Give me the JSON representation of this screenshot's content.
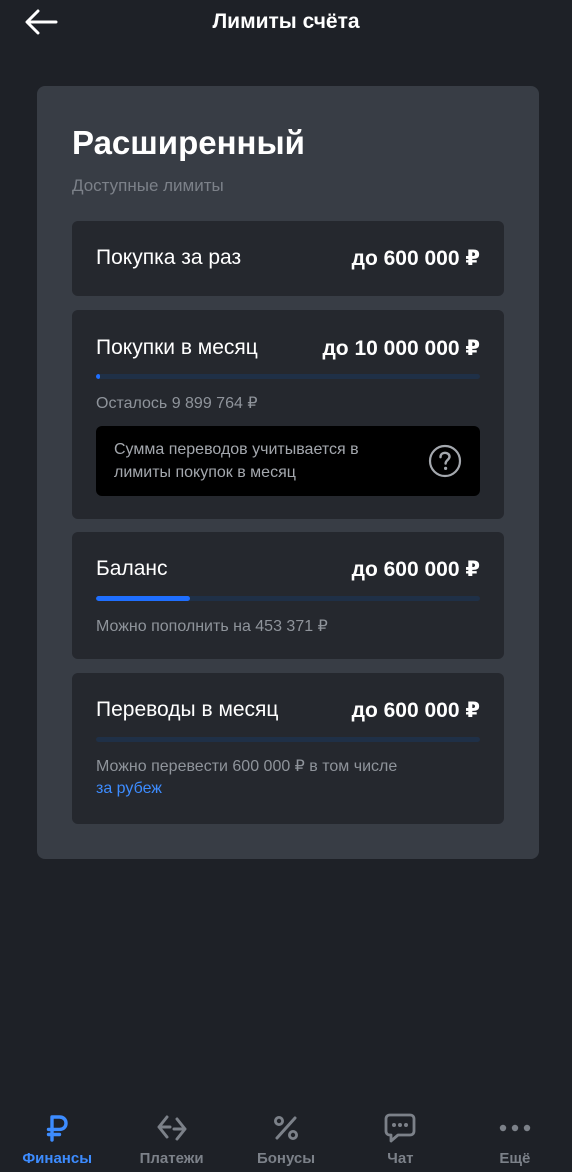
{
  "header": {
    "title": "Лимиты счёта"
  },
  "card": {
    "title": "Расширенный",
    "subtitle": "Доступные лимиты"
  },
  "limits": {
    "purchase_once": {
      "label": "Покупка за раз",
      "value": "до 600 000 ₽"
    },
    "purchases_month": {
      "label": "Покупки в месяц",
      "value": "до 10 000 000 ₽",
      "progress_fraction": 0.01,
      "remaining": "Осталось 9 899 764 ₽",
      "info": "Сумма переводов учитывается в лимиты покупок в месяц"
    },
    "balance": {
      "label": "Баланс",
      "value": "до 600 000 ₽",
      "progress_fraction": 0.245,
      "note": "Можно пополнить на 453 371 ₽"
    },
    "transfers_month": {
      "label": "Переводы в месяц",
      "value": "до 600 000 ₽",
      "progress_fraction": 0,
      "note": "Можно перевести 600 000 ₽ в том числе",
      "link": "за рубеж"
    }
  },
  "tabbar": {
    "tabs": [
      {
        "label": "Финансы",
        "icon": "ruble-icon",
        "active": true
      },
      {
        "label": "Платежи",
        "icon": "transfer-arrows-icon",
        "active": false
      },
      {
        "label": "Бонусы",
        "icon": "percent-icon",
        "active": false
      },
      {
        "label": "Чат",
        "icon": "chat-bubble-icon",
        "active": false
      },
      {
        "label": "Ещё",
        "icon": "more-dots-icon",
        "active": false
      }
    ]
  },
  "colors": {
    "background": "#1e2127",
    "card": "#383d45",
    "block": "#25282e",
    "accent": "#3d8cff",
    "progress_fill": "#1f6fff"
  }
}
